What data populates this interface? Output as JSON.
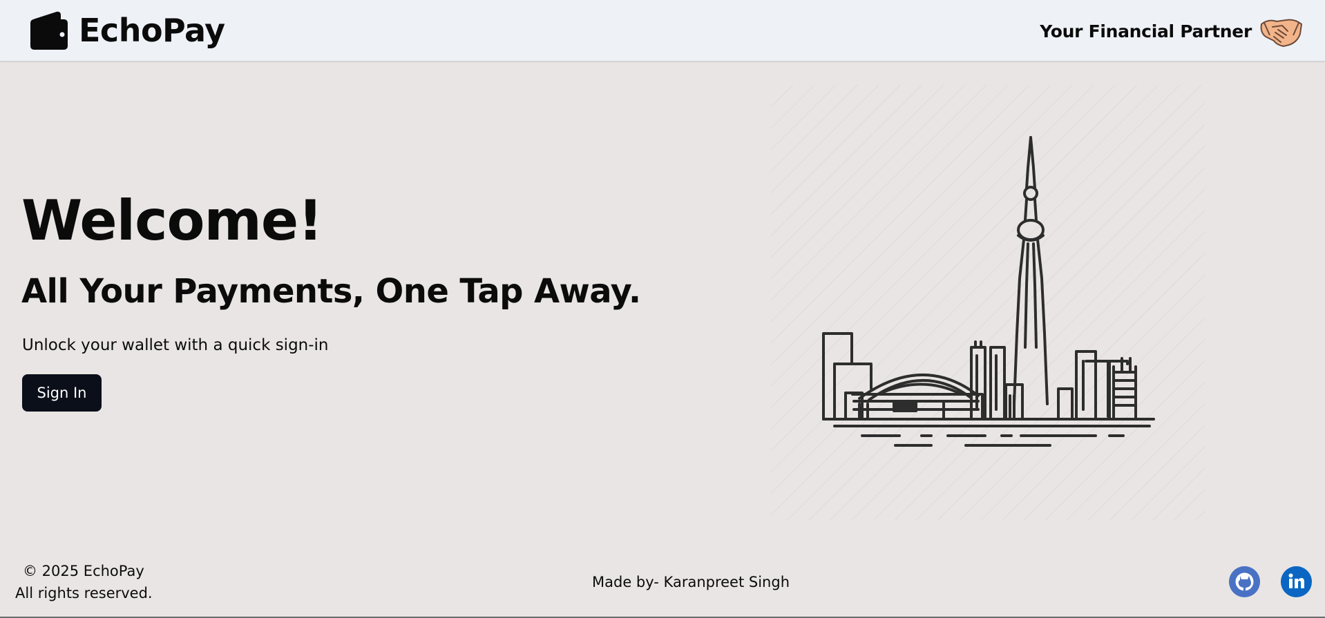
{
  "header": {
    "brand_name": "EchoPay",
    "brand_icon": "wallet-icon",
    "tagline": "Your Financial Partner",
    "tagline_icon": "handshake-icon"
  },
  "hero": {
    "title": "Welcome!",
    "subtitle": "All Your Payments, One Tap Away.",
    "text": "Unlock your wallet with a quick sign-in",
    "signin_label": "Sign In",
    "illustration": "toronto-skyline-illustration"
  },
  "footer": {
    "copyright": "© 2025 EchoPay",
    "rights": "All rights reserved.",
    "made_by": "Made by- Karanpreet Singh",
    "social": [
      {
        "name": "github-icon",
        "color": "#4a72c4"
      },
      {
        "name": "linkedin-icon",
        "color": "#0a66c2"
      }
    ]
  },
  "colors": {
    "header_bg": "#eef2f7",
    "page_bg": "#e9e5e4",
    "button_bg": "#0b0f1a",
    "button_text": "#ffffff",
    "text": "#0b0b0b"
  }
}
